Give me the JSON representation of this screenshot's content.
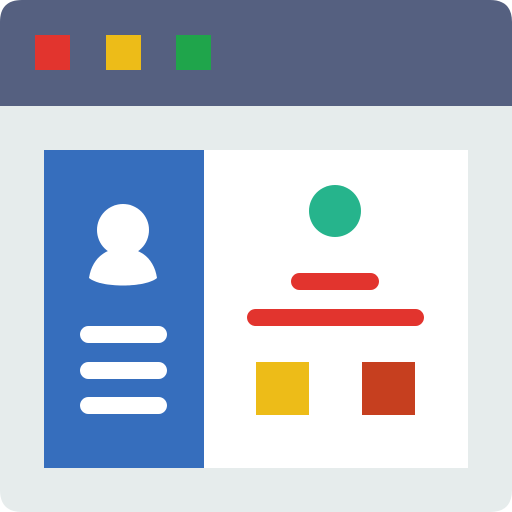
{
  "colors": {
    "window_body": "#E6ECEC",
    "title_bar": "#556080",
    "control_red": "#E2342E",
    "control_yellow": "#EDBC18",
    "control_green": "#1FA54B",
    "sidebar": "#366EBD",
    "sidebar_contents": "#FFFFFF",
    "content_panel": "#FFFFFF",
    "avatar_circle": "#26B48C",
    "red_lines": "#E2342E",
    "yellow_square": "#EDBC18",
    "orange_square": "#C63F1F"
  },
  "icons": {
    "window": "browser-window-icon",
    "close": "close-dot-icon",
    "minimize": "minimize-dot-icon",
    "maximize": "maximize-dot-icon",
    "user": "user-silhouette-icon",
    "avatar": "avatar-circle-icon",
    "text_line": "text-line-icon",
    "square": "color-square-icon"
  }
}
